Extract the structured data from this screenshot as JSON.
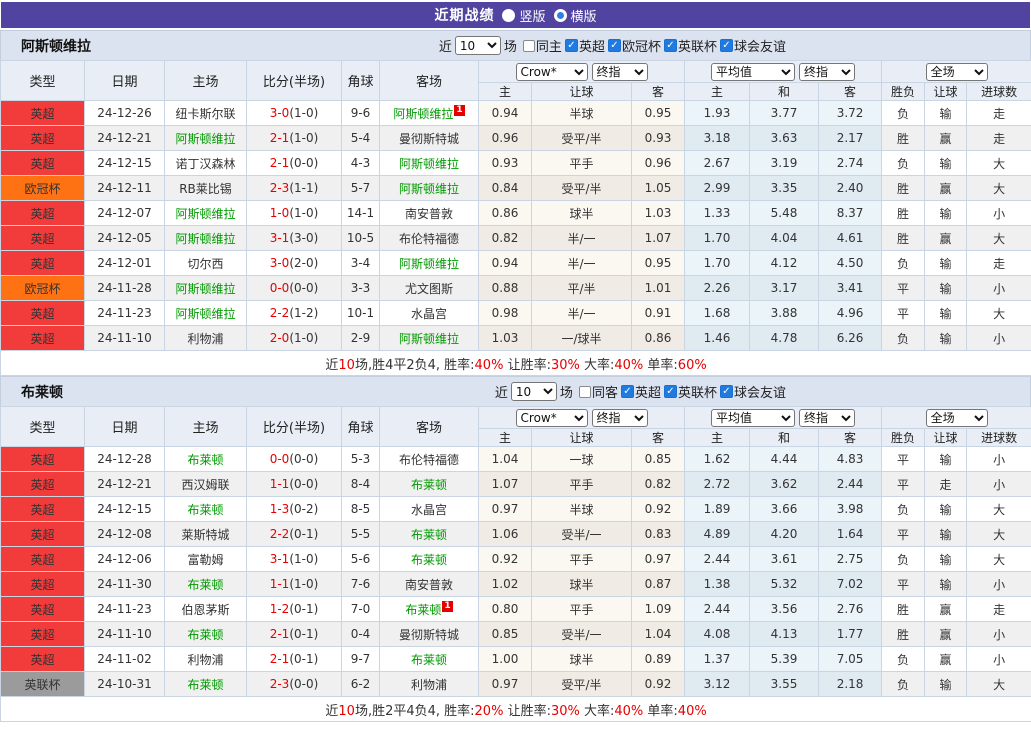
{
  "title_bar": {
    "title": "近期战绩",
    "options": [
      {
        "label": "竖版",
        "selected": false
      },
      {
        "label": "横版",
        "selected": true
      }
    ]
  },
  "table_template": {
    "near": "近",
    "games": "10",
    "games_suffix": "场",
    "main_cols": [
      "类型",
      "日期",
      "主场",
      "比分(半场)",
      "角球",
      "客场"
    ],
    "groups": [
      {
        "selects": [
          "Crow*",
          "终指"
        ],
        "cols": [
          "主",
          "让球",
          "客"
        ]
      },
      {
        "selects": [
          "平均值",
          "终指"
        ],
        "cols": [
          "主",
          "和",
          "客"
        ]
      },
      {
        "selects": [
          "全场"
        ],
        "cols": [
          "胜负",
          "让球",
          "进球数"
        ]
      }
    ]
  },
  "colors": {
    "accent_purple": "#5143a0",
    "league": {
      "英超": "#f23c3c",
      "欧冠杯": "#ff7214",
      "英联杯": "#9b9b9b"
    },
    "result": {
      "r": "#dc0000",
      "b": "#2a2ad2",
      "g": "#009a00"
    },
    "team_highlight": "#009a00",
    "score_red": "#e60000"
  },
  "sections": [
    {
      "team": "阿斯顿维拉",
      "venue_filter": "同主",
      "league_filters": [
        "英超",
        "欧冠杯",
        "英联杯",
        "球会友谊"
      ],
      "rows": [
        {
          "lg": "英超",
          "date": "24-12-26",
          "home": "纽卡斯尔联",
          "ht": false,
          "score": "3-0",
          "half": "(1-0)",
          "cr": "9-6",
          "away": "阿斯顿维拉",
          "at": true,
          "ac": "1",
          "crow": [
            "0.94",
            "半球",
            "0.95"
          ],
          "avg": [
            "1.93",
            "3.77",
            "3.72"
          ],
          "res": [
            [
              "负",
              "b"
            ],
            [
              "输",
              "b"
            ],
            [
              "走",
              "g"
            ]
          ]
        },
        {
          "lg": "英超",
          "date": "24-12-21",
          "home": "阿斯顿维拉",
          "ht": true,
          "score": "2-1",
          "half": "(1-0)",
          "cr": "5-4",
          "away": "曼彻斯特城",
          "at": false,
          "crow": [
            "0.96",
            "受平/半",
            "0.93"
          ],
          "avg": [
            "3.18",
            "3.63",
            "2.17"
          ],
          "res": [
            [
              "胜",
              "r"
            ],
            [
              "赢",
              "r"
            ],
            [
              "走",
              "g"
            ]
          ]
        },
        {
          "lg": "英超",
          "date": "24-12-15",
          "home": "诺丁汉森林",
          "ht": false,
          "score": "2-1",
          "half": "(0-0)",
          "cr": "4-3",
          "away": "阿斯顿维拉",
          "at": true,
          "crow": [
            "0.93",
            "平手",
            "0.96"
          ],
          "avg": [
            "2.67",
            "3.19",
            "2.74"
          ],
          "res": [
            [
              "负",
              "b"
            ],
            [
              "输",
              "b"
            ],
            [
              "大",
              "r"
            ]
          ]
        },
        {
          "lg": "欧冠杯",
          "date": "24-12-11",
          "home": "RB莱比锡",
          "ht": false,
          "score": "2-3",
          "half": "(1-1)",
          "cr": "5-7",
          "away": "阿斯顿维拉",
          "at": true,
          "crow": [
            "0.84",
            "受平/半",
            "1.05"
          ],
          "avg": [
            "2.99",
            "3.35",
            "2.40"
          ],
          "res": [
            [
              "胜",
              "r"
            ],
            [
              "赢",
              "r"
            ],
            [
              "大",
              "r"
            ]
          ]
        },
        {
          "lg": "英超",
          "date": "24-12-07",
          "home": "阿斯顿维拉",
          "ht": true,
          "score": "1-0",
          "half": "(1-0)",
          "cr": "14-1",
          "away": "南安普敦",
          "at": false,
          "crow": [
            "0.86",
            "球半",
            "1.03"
          ],
          "avg": [
            "1.33",
            "5.48",
            "8.37"
          ],
          "res": [
            [
              "胜",
              "r"
            ],
            [
              "输",
              "b"
            ],
            [
              "小",
              "b"
            ]
          ]
        },
        {
          "lg": "英超",
          "date": "24-12-05",
          "home": "阿斯顿维拉",
          "ht": true,
          "score": "3-1",
          "half": "(3-0)",
          "cr": "10-5",
          "away": "布伦特福德",
          "at": false,
          "crow": [
            "0.82",
            "半/一",
            "1.07"
          ],
          "avg": [
            "1.70",
            "4.04",
            "4.61"
          ],
          "res": [
            [
              "胜",
              "r"
            ],
            [
              "赢",
              "r"
            ],
            [
              "大",
              "r"
            ]
          ]
        },
        {
          "lg": "英超",
          "date": "24-12-01",
          "home": "切尔西",
          "ht": false,
          "score": "3-0",
          "half": "(2-0)",
          "cr": "3-4",
          "away": "阿斯顿维拉",
          "at": true,
          "crow": [
            "0.94",
            "半/一",
            "0.95"
          ],
          "avg": [
            "1.70",
            "4.12",
            "4.50"
          ],
          "res": [
            [
              "负",
              "b"
            ],
            [
              "输",
              "b"
            ],
            [
              "走",
              "g"
            ]
          ]
        },
        {
          "lg": "欧冠杯",
          "date": "24-11-28",
          "home": "阿斯顿维拉",
          "ht": true,
          "score": "0-0",
          "half": "(0-0)",
          "cr": "3-3",
          "away": "尤文图斯",
          "at": false,
          "crow": [
            "0.88",
            "平/半",
            "1.01"
          ],
          "avg": [
            "2.26",
            "3.17",
            "3.41"
          ],
          "res": [
            [
              "平",
              "g"
            ],
            [
              "输",
              "b"
            ],
            [
              "小",
              "b"
            ]
          ]
        },
        {
          "lg": "英超",
          "date": "24-11-23",
          "home": "阿斯顿维拉",
          "ht": true,
          "score": "2-2",
          "half": "(1-2)",
          "cr": "10-1",
          "away": "水晶宫",
          "at": false,
          "crow": [
            "0.98",
            "半/一",
            "0.91"
          ],
          "avg": [
            "1.68",
            "3.88",
            "4.96"
          ],
          "res": [
            [
              "平",
              "g"
            ],
            [
              "输",
              "b"
            ],
            [
              "大",
              "r"
            ]
          ]
        },
        {
          "lg": "英超",
          "date": "24-11-10",
          "home": "利物浦",
          "ht": false,
          "score": "2-0",
          "half": "(1-0)",
          "cr": "2-9",
          "away": "阿斯顿维拉",
          "at": true,
          "crow": [
            "1.03",
            "一/球半",
            "0.86"
          ],
          "avg": [
            "1.46",
            "4.78",
            "6.26"
          ],
          "res": [
            [
              "负",
              "b"
            ],
            [
              "输",
              "b"
            ],
            [
              "小",
              "b"
            ]
          ]
        }
      ],
      "summary": [
        {
          "t": "近",
          "c": "k"
        },
        {
          "t": "10",
          "c": "r"
        },
        {
          "t": "场,胜4平2负4, 胜率:",
          "c": "k"
        },
        {
          "t": "40%",
          "c": "r"
        },
        {
          "t": " 让胜率:",
          "c": "k"
        },
        {
          "t": "30%",
          "c": "r"
        },
        {
          "t": " 大率:",
          "c": "k"
        },
        {
          "t": "40%",
          "c": "r"
        },
        {
          "t": " 单率:",
          "c": "k"
        },
        {
          "t": "60%",
          "c": "r"
        }
      ]
    },
    {
      "team": "布莱顿",
      "venue_filter": "同客",
      "league_filters": [
        "英超",
        "英联杯",
        "球会友谊"
      ],
      "rows": [
        {
          "lg": "英超",
          "date": "24-12-28",
          "home": "布莱顿",
          "ht": true,
          "score": "0-0",
          "half": "(0-0)",
          "cr": "5-3",
          "away": "布伦特福德",
          "at": false,
          "crow": [
            "1.04",
            "一球",
            "0.85"
          ],
          "avg": [
            "1.62",
            "4.44",
            "4.83"
          ],
          "res": [
            [
              "平",
              "g"
            ],
            [
              "输",
              "b"
            ],
            [
              "小",
              "b"
            ]
          ]
        },
        {
          "lg": "英超",
          "date": "24-12-21",
          "home": "西汉姆联",
          "ht": false,
          "score": "1-1",
          "half": "(0-0)",
          "cr": "8-4",
          "away": "布莱顿",
          "at": true,
          "crow": [
            "1.07",
            "平手",
            "0.82"
          ],
          "avg": [
            "2.72",
            "3.62",
            "2.44"
          ],
          "res": [
            [
              "平",
              "g"
            ],
            [
              "走",
              "g"
            ],
            [
              "小",
              "b"
            ]
          ]
        },
        {
          "lg": "英超",
          "date": "24-12-15",
          "home": "布莱顿",
          "ht": true,
          "score": "1-3",
          "half": "(0-2)",
          "cr": "8-5",
          "away": "水晶宫",
          "at": false,
          "crow": [
            "0.97",
            "半球",
            "0.92"
          ],
          "avg": [
            "1.89",
            "3.66",
            "3.98"
          ],
          "res": [
            [
              "负",
              "b"
            ],
            [
              "输",
              "b"
            ],
            [
              "大",
              "r"
            ]
          ]
        },
        {
          "lg": "英超",
          "date": "24-12-08",
          "home": "莱斯特城",
          "ht": false,
          "score": "2-2",
          "half": "(0-1)",
          "cr": "5-5",
          "away": "布莱顿",
          "at": true,
          "crow": [
            "1.06",
            "受半/一",
            "0.83"
          ],
          "avg": [
            "4.89",
            "4.20",
            "1.64"
          ],
          "res": [
            [
              "平",
              "g"
            ],
            [
              "输",
              "b"
            ],
            [
              "大",
              "r"
            ]
          ]
        },
        {
          "lg": "英超",
          "date": "24-12-06",
          "home": "富勒姆",
          "ht": false,
          "score": "3-1",
          "half": "(1-0)",
          "cr": "5-6",
          "away": "布莱顿",
          "at": true,
          "crow": [
            "0.92",
            "平手",
            "0.97"
          ],
          "avg": [
            "2.44",
            "3.61",
            "2.75"
          ],
          "res": [
            [
              "负",
              "b"
            ],
            [
              "输",
              "b"
            ],
            [
              "大",
              "r"
            ]
          ]
        },
        {
          "lg": "英超",
          "date": "24-11-30",
          "home": "布莱顿",
          "ht": true,
          "score": "1-1",
          "half": "(1-0)",
          "cr": "7-6",
          "away": "南安普敦",
          "at": false,
          "crow": [
            "1.02",
            "球半",
            "0.87"
          ],
          "avg": [
            "1.38",
            "5.32",
            "7.02"
          ],
          "res": [
            [
              "平",
              "g"
            ],
            [
              "输",
              "b"
            ],
            [
              "小",
              "b"
            ]
          ]
        },
        {
          "lg": "英超",
          "date": "24-11-23",
          "home": "伯恩茅斯",
          "ht": false,
          "score": "1-2",
          "half": "(0-1)",
          "cr": "7-0",
          "away": "布莱顿",
          "at": true,
          "ac": "1",
          "crow": [
            "0.80",
            "平手",
            "1.09"
          ],
          "avg": [
            "2.44",
            "3.56",
            "2.76"
          ],
          "res": [
            [
              "胜",
              "r"
            ],
            [
              "赢",
              "r"
            ],
            [
              "走",
              "g"
            ]
          ]
        },
        {
          "lg": "英超",
          "date": "24-11-10",
          "home": "布莱顿",
          "ht": true,
          "score": "2-1",
          "half": "(0-1)",
          "cr": "0-4",
          "away": "曼彻斯特城",
          "at": false,
          "crow": [
            "0.85",
            "受半/一",
            "1.04"
          ],
          "avg": [
            "4.08",
            "4.13",
            "1.77"
          ],
          "res": [
            [
              "胜",
              "r"
            ],
            [
              "赢",
              "r"
            ],
            [
              "小",
              "b"
            ]
          ]
        },
        {
          "lg": "英超",
          "date": "24-11-02",
          "home": "利物浦",
          "ht": false,
          "score": "2-1",
          "half": "(0-1)",
          "cr": "9-7",
          "away": "布莱顿",
          "at": true,
          "crow": [
            "1.00",
            "球半",
            "0.89"
          ],
          "avg": [
            "1.37",
            "5.39",
            "7.05"
          ],
          "res": [
            [
              "负",
              "b"
            ],
            [
              "赢",
              "r"
            ],
            [
              "小",
              "b"
            ]
          ]
        },
        {
          "lg": "英联杯",
          "date": "24-10-31",
          "home": "布莱顿",
          "ht": true,
          "score": "2-3",
          "half": "(0-0)",
          "cr": "6-2",
          "away": "利物浦",
          "at": false,
          "crow": [
            "0.97",
            "受平/半",
            "0.92"
          ],
          "avg": [
            "3.12",
            "3.55",
            "2.18"
          ],
          "res": [
            [
              "负",
              "b"
            ],
            [
              "输",
              "b"
            ],
            [
              "大",
              "r"
            ]
          ]
        }
      ],
      "summary": [
        {
          "t": "近",
          "c": "k"
        },
        {
          "t": "10",
          "c": "r"
        },
        {
          "t": "场,胜2平4负4, 胜率:",
          "c": "k"
        },
        {
          "t": "20%",
          "c": "r"
        },
        {
          "t": " 让胜率:",
          "c": "k"
        },
        {
          "t": "30%",
          "c": "r"
        },
        {
          "t": " 大率:",
          "c": "k"
        },
        {
          "t": "40%",
          "c": "r"
        },
        {
          "t": " 单率:",
          "c": "k"
        },
        {
          "t": "40%",
          "c": "r"
        }
      ]
    }
  ]
}
